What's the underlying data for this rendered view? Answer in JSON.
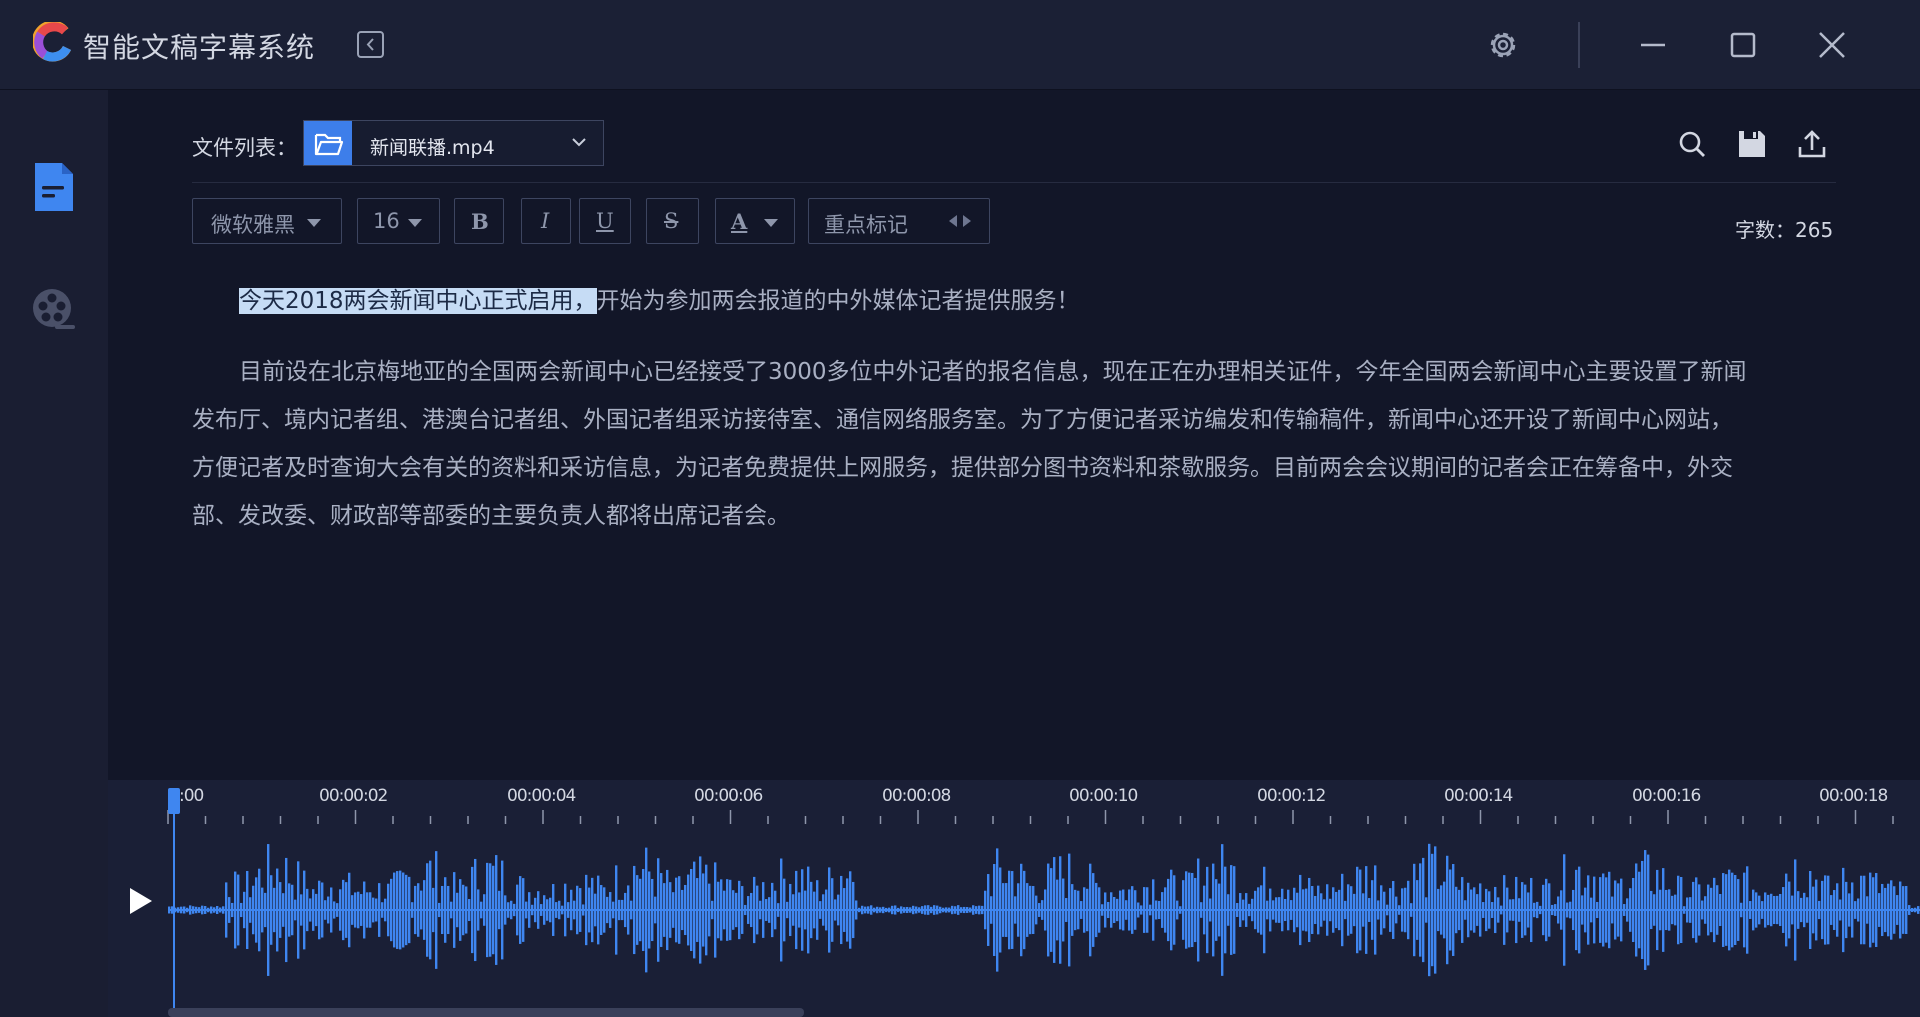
{
  "titlebar": {
    "app_title": "智能文稿字幕系统",
    "icons": [
      "app-logo-icon",
      "collapse-left-icon",
      "gear-icon",
      "minimize-icon",
      "maximize-icon",
      "close-icon"
    ]
  },
  "sidebar": {
    "items": [
      {
        "name": "document",
        "icon": "document-icon",
        "active": true
      },
      {
        "name": "film",
        "icon": "film-reel-icon",
        "active": false
      }
    ]
  },
  "file_bar": {
    "label": "文件列表：",
    "selected_file": "新闻联播.mp4",
    "tools": [
      "search-icon",
      "save-icon",
      "upload-icon"
    ]
  },
  "format_toolbar": {
    "font_family": "微软雅黑",
    "font_size": "16",
    "bold": "B",
    "italic": "I",
    "underline": "U",
    "strike": "S",
    "font_color": "A",
    "highlight_label": "重点标记",
    "word_count_label": "字数：",
    "word_count": "265"
  },
  "editor": {
    "para1_selected": "今天2018两会新闻中心正式启用，",
    "para1_rest": "开始为参加两会报道的中外媒体记者提供服务！",
    "para2_line1": "目前设在北京梅地亚的全国两会新闻中心已经接受了3000多位中外记者的报名信息，现在正在办理相关证件，今年全国两会新闻中心主要设置了新闻",
    "para2_line2": "发布厅、境内记者组、港澳台记者组、外国记者组采访接待室、通信网络服务室。为了方便记者采访编发和传输稿件，新闻中心还开设了新闻中心网站，",
    "para2_line3": "方便记者及时查询大会有关的资料和采访信息，为记者免费提供上网服务，提供部分图书资料和茶歇服务。目前两会会议期间的记者会正在筹备中，外交",
    "para2_line4": "部、发改委、财政部等部委的主要负责人都将出席记者会。"
  },
  "timeline": {
    "labels": [
      ":00",
      "00:00:02",
      "00:00:04",
      "00:00:06",
      "00:00:08",
      "00:00:10",
      "00:00:12",
      "00:00:14",
      "00:00:16",
      "00:00:18"
    ],
    "accent": "#3f86f0"
  },
  "colors": {
    "accent": "#3d7eea",
    "background": "#121628",
    "panel": "#1a1e32",
    "selection": "#c6dcf5"
  }
}
